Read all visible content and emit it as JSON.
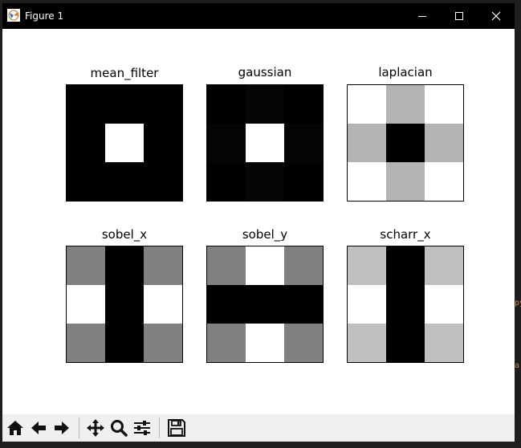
{
  "window": {
    "title": "Figure 1",
    "icon": "matplotlib-figure-icon"
  },
  "subplots": [
    {
      "title": "mean_filter",
      "grid": [
        [
          0,
          0,
          0
        ],
        [
          0,
          1,
          0
        ],
        [
          0,
          0,
          0
        ]
      ]
    },
    {
      "title": "gaussian",
      "grid": [
        [
          0,
          0.02,
          0
        ],
        [
          0.02,
          1,
          0.02
        ],
        [
          0,
          0.02,
          0
        ]
      ]
    },
    {
      "title": "laplacian",
      "grid": [
        [
          1,
          0.7,
          1
        ],
        [
          0.7,
          0,
          0.7
        ],
        [
          1,
          0.7,
          1
        ]
      ]
    },
    {
      "title": "sobel_x",
      "grid": [
        [
          0.5,
          0,
          0.5
        ],
        [
          1,
          0,
          1
        ],
        [
          0.5,
          0,
          0.5
        ]
      ]
    },
    {
      "title": "sobel_y",
      "grid": [
        [
          0.5,
          1,
          0.5
        ],
        [
          0,
          0,
          0
        ],
        [
          0.5,
          1,
          0.5
        ]
      ]
    },
    {
      "title": "scharr_x",
      "grid": [
        [
          0.75,
          0,
          0.75
        ],
        [
          1,
          0,
          1
        ],
        [
          0.75,
          0,
          0.75
        ]
      ]
    }
  ],
  "toolbar": {
    "buttons": [
      "home-icon",
      "back-arrow-icon",
      "forward-arrow-icon",
      "pan-icon",
      "zoom-icon",
      "configure-subplots-icon",
      "save-icon"
    ]
  },
  "side_text": [
    "py",
    "a"
  ]
}
